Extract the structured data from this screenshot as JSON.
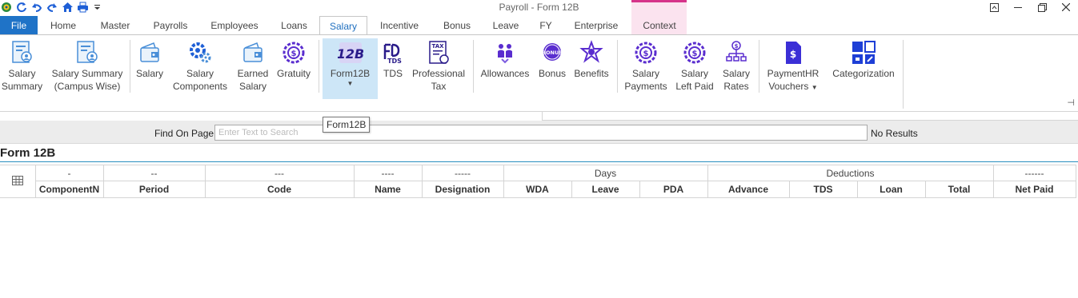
{
  "window": {
    "title": "Payroll - Form 12B"
  },
  "quick_access": [
    {
      "icon": "app-globe-icon"
    },
    {
      "icon": "refresh-icon"
    },
    {
      "icon": "undo-icon"
    },
    {
      "icon": "redo-icon"
    },
    {
      "icon": "home-icon"
    },
    {
      "icon": "print-icon"
    },
    {
      "icon": "customize-dropdown-icon"
    }
  ],
  "tabs": [
    {
      "label": "File"
    },
    {
      "label": "Home"
    },
    {
      "label": "Master"
    },
    {
      "label": "Payrolls"
    },
    {
      "label": "Employees"
    },
    {
      "label": "Loans"
    },
    {
      "label": "Salary"
    },
    {
      "label": "Incentive"
    },
    {
      "label": "Bonus"
    },
    {
      "label": "Leave"
    },
    {
      "label": "FY"
    },
    {
      "label": "Enterprise"
    },
    {
      "label": "Context"
    }
  ],
  "active_tab": "Salary",
  "ribbon": {
    "buttons": [
      {
        "line1": "Salary",
        "line2": "Summary",
        "icon": "salary-summary-icon"
      },
      {
        "line1": "Salary Summary",
        "line2": "(Campus Wise)",
        "icon": "salary-summary-campus-icon"
      },
      {
        "line1": "Salary",
        "line2": "",
        "icon": "wallet-icon"
      },
      {
        "line1": "Salary",
        "line2": "Components",
        "icon": "components-gear-icon"
      },
      {
        "line1": "Earned",
        "line2": "Salary",
        "icon": "earned-wallet-icon"
      },
      {
        "line1": "Gratuity",
        "line2": "",
        "icon": "gratuity-gear-icon"
      },
      {
        "line1": "Form12B",
        "line2": "",
        "icon": "form-12b-icon",
        "dropdown": true
      },
      {
        "line1": "TDS",
        "line2": "",
        "icon": "tds-icon"
      },
      {
        "line1": "Professional",
        "line2": "Tax",
        "icon": "professional-tax-icon"
      },
      {
        "line1": "Allowances",
        "line2": "",
        "icon": "allowances-icon"
      },
      {
        "line1": "Bonus",
        "line2": "",
        "icon": "bonus-icon"
      },
      {
        "line1": "Benefits",
        "line2": "",
        "icon": "benefits-icon"
      },
      {
        "line1": "Salary",
        "line2": "Payments",
        "icon": "salary-payments-icon"
      },
      {
        "line1": "Salary",
        "line2": "Left Paid",
        "icon": "salary-left-paid-icon"
      },
      {
        "line1": "Salary",
        "line2": "Rates",
        "icon": "salary-rates-icon"
      },
      {
        "line1": "PaymentHR",
        "line2": "Vouchers",
        "icon": "paymenthr-vouchers-icon",
        "dropdown": true
      },
      {
        "line1": "Categorization",
        "line2": "",
        "icon": "categorization-icon"
      }
    ]
  },
  "tooltip": "Form12B",
  "find": {
    "label": "Find On Page",
    "placeholder": "Enter Text to Search",
    "value": "",
    "result": "No Results"
  },
  "page_title": "Form 12B",
  "grid": {
    "header_top": [
      "-",
      "--",
      "---",
      "----",
      "-----",
      "Days",
      "Deductions",
      "------"
    ],
    "header_bottom": [
      "ComponentN",
      "Period",
      "Code",
      "Name",
      "Designation",
      "WDA",
      "Leave",
      "PDA",
      "Advance",
      "TDS",
      "Loan",
      "Total",
      "Net Paid"
    ],
    "rows": []
  },
  "colors": {
    "accent": "#1f73c7",
    "context_tab": "#d6338a",
    "icon_blue": "#1e5fd6",
    "icon_purple": "#5a2dcf"
  }
}
